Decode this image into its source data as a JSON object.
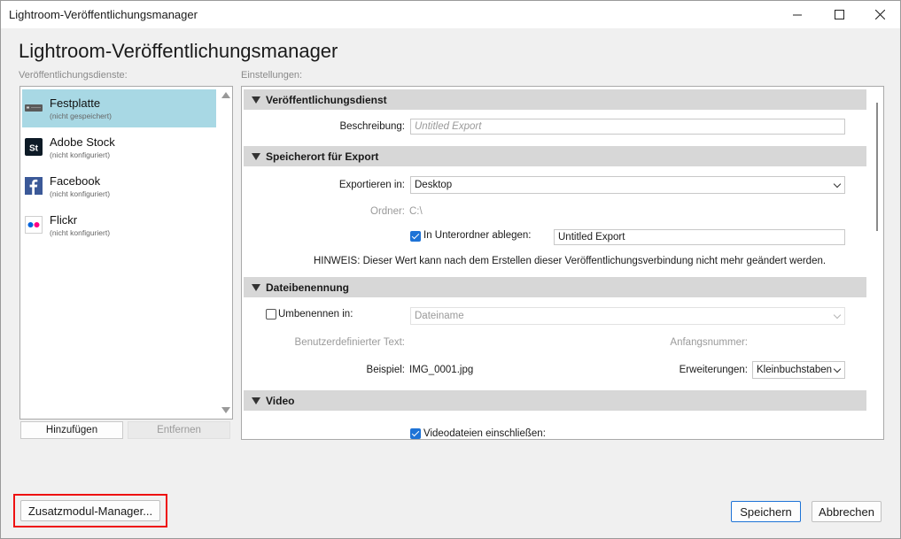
{
  "window": {
    "title": "Lightroom-Veröffentlichungsmanager"
  },
  "heading": "Lightroom-Veröffentlichungsmanager",
  "services_label": "Veröffentlichungsdienste:",
  "settings_label": "Einstellungen:",
  "services": [
    {
      "name": "Festplatte",
      "status": "(nicht gespeichert)",
      "icon": "hard-drive-icon",
      "selected": true
    },
    {
      "name": "Adobe Stock",
      "status": "(nicht konfiguriert)",
      "icon": "adobe-stock-icon",
      "selected": false
    },
    {
      "name": "Facebook",
      "status": "(nicht konfiguriert)",
      "icon": "facebook-icon",
      "selected": false
    },
    {
      "name": "Flickr",
      "status": "(nicht konfiguriert)",
      "icon": "flickr-icon",
      "selected": false
    }
  ],
  "list_buttons": {
    "add": "Hinzufügen",
    "remove": "Entfernen"
  },
  "sections": {
    "publish_service": {
      "title": "Veröffentlichungsdienst",
      "description_label": "Beschreibung:",
      "description_placeholder": "Untitled Export"
    },
    "export_location": {
      "title": "Speicherort für Export",
      "export_to_label": "Exportieren in:",
      "export_to_value": "Desktop",
      "folder_label": "Ordner:",
      "folder_value": "C:\\",
      "subfolder_label": "In Unterordner ablegen:",
      "subfolder_checked": true,
      "subfolder_value": "Untitled Export",
      "note": "HINWEIS: Dieser Wert kann nach dem Erstellen dieser Veröffentlichungsverbindung nicht mehr geändert werden."
    },
    "file_naming": {
      "title": "Dateibenennung",
      "rename_label": "Umbenennen in:",
      "rename_checked": false,
      "rename_value": "Dateiname",
      "custom_text_label": "Benutzerdefinierter Text:",
      "start_number_label": "Anfangsnummer:",
      "example_label": "Beispiel:",
      "example_value": "IMG_0001.jpg",
      "extensions_label": "Erweiterungen:",
      "extensions_value": "Kleinbuchstaben"
    },
    "video": {
      "title": "Video",
      "include_label": "Videodateien einschließen:",
      "include_checked": true
    }
  },
  "footer": {
    "plugin_manager": "Zusatzmodul-Manager...",
    "save": "Speichern",
    "cancel": "Abbrechen"
  },
  "colors": {
    "selection": "#a8d8e4",
    "accent": "#1e73d6",
    "highlight": "#ee1111"
  }
}
